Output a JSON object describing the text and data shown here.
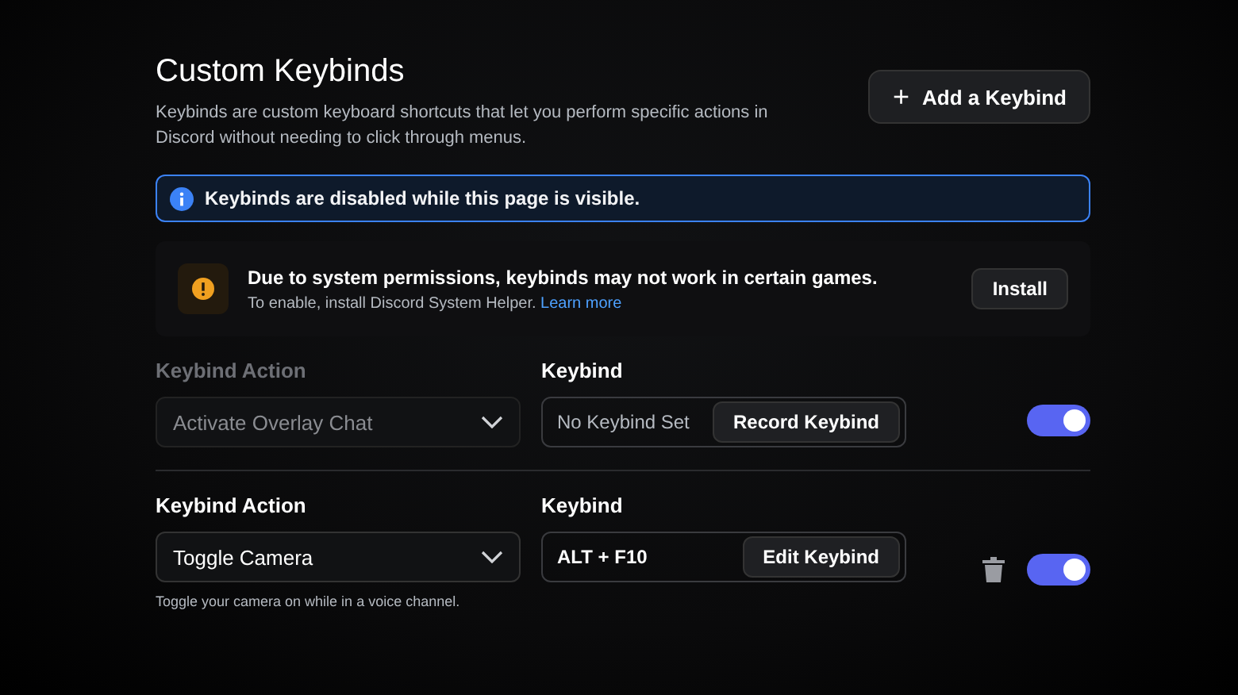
{
  "header": {
    "title": "Custom Keybinds",
    "description": "Keybinds are custom keyboard shortcuts that let you perform specific actions in Discord without needing to click through menus.",
    "add_button": "+",
    "add_label": "Add a Keybind"
  },
  "info_notice": {
    "text": "Keybinds are disabled while this page is visible."
  },
  "warning": {
    "title": "Due to system permissions, keybinds may not work in certain games.",
    "text": "To enable, install Discord System Helper.",
    "link": "Learn more",
    "button": "Install"
  },
  "keybinds": [
    {
      "action_label": "Keybind Action",
      "action": "Activate Overlay Chat",
      "disabled": true,
      "keybind_label": "Keybind",
      "keybind": "No Keybind Set",
      "kind": "empty",
      "button": "Record Keybind",
      "deletable": false,
      "on": true
    },
    {
      "action_label": "Keybind Action",
      "action": "Toggle Camera",
      "disabled": false,
      "keybind_label": "Keybind",
      "keybind": "ALT + F10",
      "kind": "set",
      "button": "Edit Keybind",
      "deletable": true,
      "on": true,
      "description": "Toggle your camera on while in a voice channel."
    }
  ]
}
